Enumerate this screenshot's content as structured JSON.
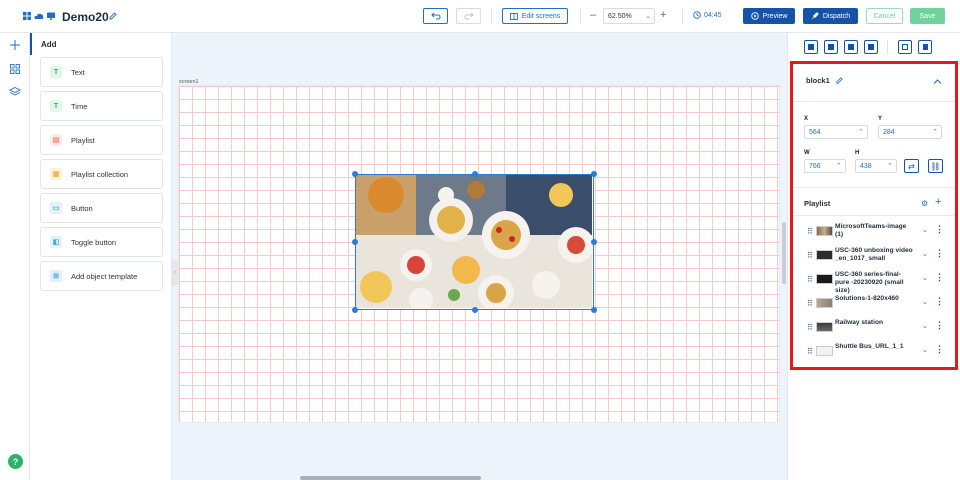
{
  "app": {
    "title": "Demo20",
    "edit_screens_label": "Edit screens",
    "zoom": "62.50%",
    "duration": "04:45",
    "preview_label": "Preview",
    "dispatch_label": "Dispatch",
    "cancel_label": "Cancel",
    "save_label": "Save"
  },
  "add_panel": {
    "heading": "Add",
    "items": [
      {
        "label": "Text",
        "icon": "text-icon",
        "color": "#2cb36b"
      },
      {
        "label": "Time",
        "icon": "time-icon",
        "color": "#2cb36b"
      },
      {
        "label": "Playlist",
        "icon": "playlist-icon",
        "color": "#f08a7a"
      },
      {
        "label": "Playlist collection",
        "icon": "playlist-collection-icon",
        "color": "#f0b24a"
      },
      {
        "label": "Button",
        "icon": "button-icon",
        "color": "#4aa8e0"
      },
      {
        "label": "Toggle button",
        "icon": "toggle-button-icon",
        "color": "#4aa8e0"
      },
      {
        "label": "Add object template",
        "icon": "template-icon",
        "color": "#4aa8e0"
      }
    ]
  },
  "canvas": {
    "screen_label": "screen1"
  },
  "properties": {
    "block_name": "block1",
    "x_label": "X",
    "x_value": "564",
    "y_label": "Y",
    "y_value": "284",
    "w_label": "W",
    "w_value": "766",
    "h_label": "H",
    "h_value": "438",
    "playlist_title": "Playlist",
    "playlist": [
      {
        "name": "MicrosoftTeams-image (1)"
      },
      {
        "name": "USC-360 unboxing video _en_1017_small"
      },
      {
        "name": "USC-360 series-final-pure -20230920 (small size)"
      },
      {
        "name": "Solutions-1-820x460"
      },
      {
        "name": "Railway station"
      },
      {
        "name": "Shuttle Bus_URL_1_1"
      }
    ]
  },
  "colors": {
    "accent": "#1553a8",
    "highlight": "#e01b1b",
    "save": "#6fd39a"
  }
}
